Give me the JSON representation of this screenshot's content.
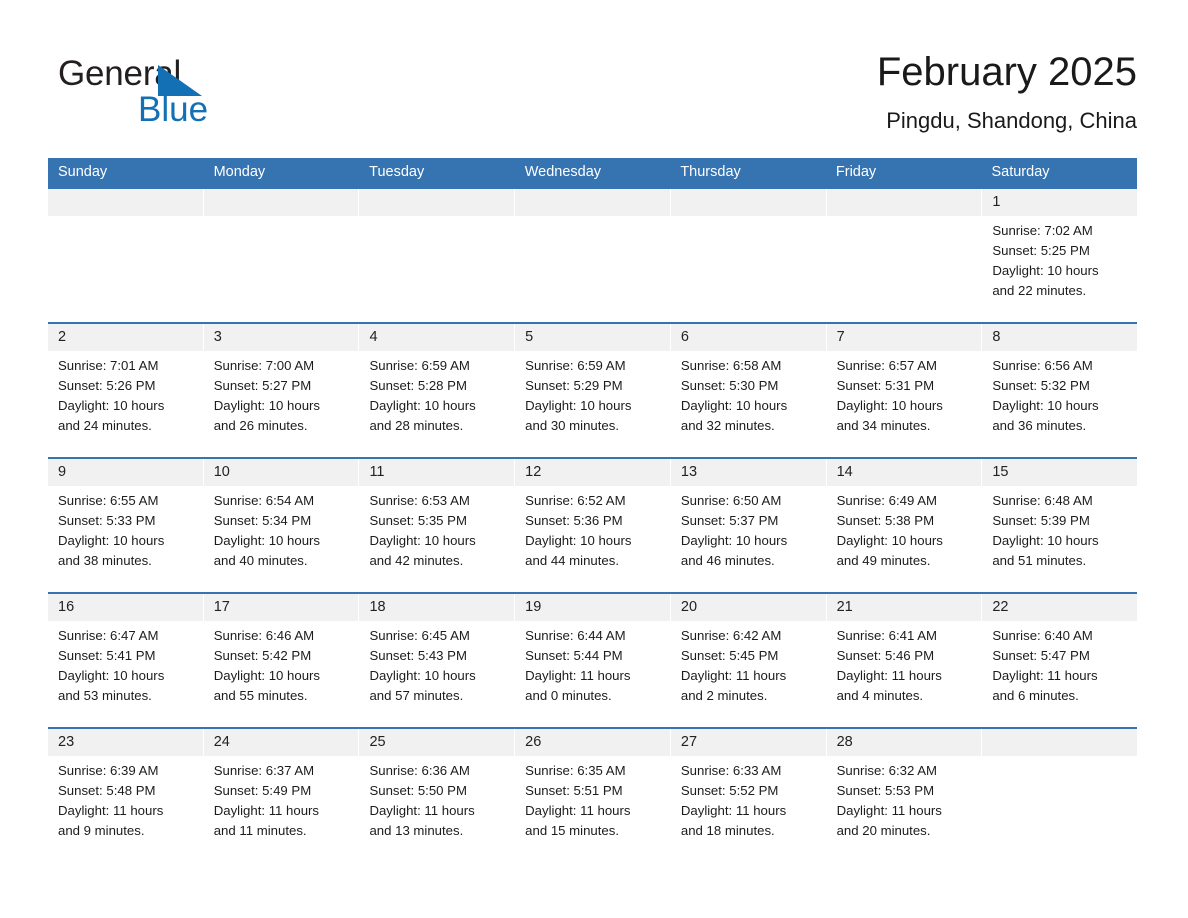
{
  "brand": {
    "name_part1": "General",
    "name_part2": "Blue",
    "triangle_icon": "triangle-icon",
    "color_primary": "#1470b5",
    "color_text": "#231f20"
  },
  "header": {
    "title": "February 2025",
    "subtitle": "Pingdu, Shandong, China"
  },
  "theme": {
    "header_blue": "#3573b1",
    "day_band_gray": "#f1f1f1",
    "text": "#1c1c1c"
  },
  "weekdays": [
    "Sunday",
    "Monday",
    "Tuesday",
    "Wednesday",
    "Thursday",
    "Friday",
    "Saturday"
  ],
  "weeks": [
    [
      {
        "day": "",
        "sunrise": "",
        "sunset": "",
        "daylight1": "",
        "daylight2": ""
      },
      {
        "day": "",
        "sunrise": "",
        "sunset": "",
        "daylight1": "",
        "daylight2": ""
      },
      {
        "day": "",
        "sunrise": "",
        "sunset": "",
        "daylight1": "",
        "daylight2": ""
      },
      {
        "day": "",
        "sunrise": "",
        "sunset": "",
        "daylight1": "",
        "daylight2": ""
      },
      {
        "day": "",
        "sunrise": "",
        "sunset": "",
        "daylight1": "",
        "daylight2": ""
      },
      {
        "day": "",
        "sunrise": "",
        "sunset": "",
        "daylight1": "",
        "daylight2": ""
      },
      {
        "day": "1",
        "sunrise": "Sunrise: 7:02 AM",
        "sunset": "Sunset: 5:25 PM",
        "daylight1": "Daylight: 10 hours",
        "daylight2": "and 22 minutes."
      }
    ],
    [
      {
        "day": "2",
        "sunrise": "Sunrise: 7:01 AM",
        "sunset": "Sunset: 5:26 PM",
        "daylight1": "Daylight: 10 hours",
        "daylight2": "and 24 minutes."
      },
      {
        "day": "3",
        "sunrise": "Sunrise: 7:00 AM",
        "sunset": "Sunset: 5:27 PM",
        "daylight1": "Daylight: 10 hours",
        "daylight2": "and 26 minutes."
      },
      {
        "day": "4",
        "sunrise": "Sunrise: 6:59 AM",
        "sunset": "Sunset: 5:28 PM",
        "daylight1": "Daylight: 10 hours",
        "daylight2": "and 28 minutes."
      },
      {
        "day": "5",
        "sunrise": "Sunrise: 6:59 AM",
        "sunset": "Sunset: 5:29 PM",
        "daylight1": "Daylight: 10 hours",
        "daylight2": "and 30 minutes."
      },
      {
        "day": "6",
        "sunrise": "Sunrise: 6:58 AM",
        "sunset": "Sunset: 5:30 PM",
        "daylight1": "Daylight: 10 hours",
        "daylight2": "and 32 minutes."
      },
      {
        "day": "7",
        "sunrise": "Sunrise: 6:57 AM",
        "sunset": "Sunset: 5:31 PM",
        "daylight1": "Daylight: 10 hours",
        "daylight2": "and 34 minutes."
      },
      {
        "day": "8",
        "sunrise": "Sunrise: 6:56 AM",
        "sunset": "Sunset: 5:32 PM",
        "daylight1": "Daylight: 10 hours",
        "daylight2": "and 36 minutes."
      }
    ],
    [
      {
        "day": "9",
        "sunrise": "Sunrise: 6:55 AM",
        "sunset": "Sunset: 5:33 PM",
        "daylight1": "Daylight: 10 hours",
        "daylight2": "and 38 minutes."
      },
      {
        "day": "10",
        "sunrise": "Sunrise: 6:54 AM",
        "sunset": "Sunset: 5:34 PM",
        "daylight1": "Daylight: 10 hours",
        "daylight2": "and 40 minutes."
      },
      {
        "day": "11",
        "sunrise": "Sunrise: 6:53 AM",
        "sunset": "Sunset: 5:35 PM",
        "daylight1": "Daylight: 10 hours",
        "daylight2": "and 42 minutes."
      },
      {
        "day": "12",
        "sunrise": "Sunrise: 6:52 AM",
        "sunset": "Sunset: 5:36 PM",
        "daylight1": "Daylight: 10 hours",
        "daylight2": "and 44 minutes."
      },
      {
        "day": "13",
        "sunrise": "Sunrise: 6:50 AM",
        "sunset": "Sunset: 5:37 PM",
        "daylight1": "Daylight: 10 hours",
        "daylight2": "and 46 minutes."
      },
      {
        "day": "14",
        "sunrise": "Sunrise: 6:49 AM",
        "sunset": "Sunset: 5:38 PM",
        "daylight1": "Daylight: 10 hours",
        "daylight2": "and 49 minutes."
      },
      {
        "day": "15",
        "sunrise": "Sunrise: 6:48 AM",
        "sunset": "Sunset: 5:39 PM",
        "daylight1": "Daylight: 10 hours",
        "daylight2": "and 51 minutes."
      }
    ],
    [
      {
        "day": "16",
        "sunrise": "Sunrise: 6:47 AM",
        "sunset": "Sunset: 5:41 PM",
        "daylight1": "Daylight: 10 hours",
        "daylight2": "and 53 minutes."
      },
      {
        "day": "17",
        "sunrise": "Sunrise: 6:46 AM",
        "sunset": "Sunset: 5:42 PM",
        "daylight1": "Daylight: 10 hours",
        "daylight2": "and 55 minutes."
      },
      {
        "day": "18",
        "sunrise": "Sunrise: 6:45 AM",
        "sunset": "Sunset: 5:43 PM",
        "daylight1": "Daylight: 10 hours",
        "daylight2": "and 57 minutes."
      },
      {
        "day": "19",
        "sunrise": "Sunrise: 6:44 AM",
        "sunset": "Sunset: 5:44 PM",
        "daylight1": "Daylight: 11 hours",
        "daylight2": "and 0 minutes."
      },
      {
        "day": "20",
        "sunrise": "Sunrise: 6:42 AM",
        "sunset": "Sunset: 5:45 PM",
        "daylight1": "Daylight: 11 hours",
        "daylight2": "and 2 minutes."
      },
      {
        "day": "21",
        "sunrise": "Sunrise: 6:41 AM",
        "sunset": "Sunset: 5:46 PM",
        "daylight1": "Daylight: 11 hours",
        "daylight2": "and 4 minutes."
      },
      {
        "day": "22",
        "sunrise": "Sunrise: 6:40 AM",
        "sunset": "Sunset: 5:47 PM",
        "daylight1": "Daylight: 11 hours",
        "daylight2": "and 6 minutes."
      }
    ],
    [
      {
        "day": "23",
        "sunrise": "Sunrise: 6:39 AM",
        "sunset": "Sunset: 5:48 PM",
        "daylight1": "Daylight: 11 hours",
        "daylight2": "and 9 minutes."
      },
      {
        "day": "24",
        "sunrise": "Sunrise: 6:37 AM",
        "sunset": "Sunset: 5:49 PM",
        "daylight1": "Daylight: 11 hours",
        "daylight2": "and 11 minutes."
      },
      {
        "day": "25",
        "sunrise": "Sunrise: 6:36 AM",
        "sunset": "Sunset: 5:50 PM",
        "daylight1": "Daylight: 11 hours",
        "daylight2": "and 13 minutes."
      },
      {
        "day": "26",
        "sunrise": "Sunrise: 6:35 AM",
        "sunset": "Sunset: 5:51 PM",
        "daylight1": "Daylight: 11 hours",
        "daylight2": "and 15 minutes."
      },
      {
        "day": "27",
        "sunrise": "Sunrise: 6:33 AM",
        "sunset": "Sunset: 5:52 PM",
        "daylight1": "Daylight: 11 hours",
        "daylight2": "and 18 minutes."
      },
      {
        "day": "28",
        "sunrise": "Sunrise: 6:32 AM",
        "sunset": "Sunset: 5:53 PM",
        "daylight1": "Daylight: 11 hours",
        "daylight2": "and 20 minutes."
      },
      {
        "day": "",
        "sunrise": "",
        "sunset": "",
        "daylight1": "",
        "daylight2": ""
      }
    ]
  ]
}
